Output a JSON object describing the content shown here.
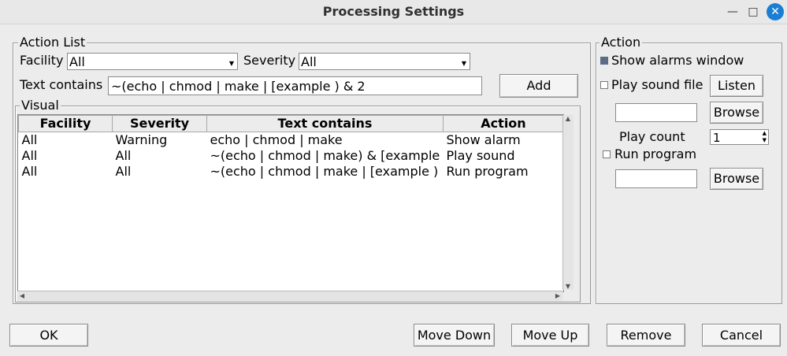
{
  "window": {
    "title": "Processing Settings",
    "minimize_icon": "minimize-icon",
    "maximize_icon": "maximize-icon",
    "close_icon": "close-icon"
  },
  "action_list": {
    "legend": "Action List",
    "facility_label": "Facility",
    "facility_value": "All",
    "severity_label": "Severity",
    "severity_value": "All",
    "text_contains_label": "Text contains",
    "text_contains_value": "~(echo | chmod | make | [example ) & 2",
    "add_label": "Add"
  },
  "visual": {
    "legend": "Visual",
    "columns": [
      "Facility",
      "Severity",
      "Text contains",
      "Action"
    ],
    "rows": [
      {
        "facility": "All",
        "severity": "Warning",
        "text": "echo | chmod | make",
        "action": "Show alarm"
      },
      {
        "facility": "All",
        "severity": "All",
        "text": "~(echo | chmod | make) & [example",
        "action": "Play sound"
      },
      {
        "facility": "All",
        "severity": "All",
        "text": "~(echo | chmod | make | [example )",
        "action": "Run program"
      }
    ]
  },
  "action": {
    "legend": "Action",
    "show_alarms_label": "Show alarms window",
    "show_alarms_checked": true,
    "play_sound_label": "Play sound file",
    "play_sound_checked": false,
    "listen_label": "Listen",
    "sound_file_value": "",
    "browse_label": "Browse",
    "play_count_label": "Play count",
    "play_count_value": "1",
    "run_program_label": "Run program",
    "run_program_checked": false,
    "program_value": "",
    "browse2_label": "Browse"
  },
  "footer": {
    "ok_label": "OK",
    "move_down_label": "Move Down",
    "move_up_label": "Move Up",
    "remove_label": "Remove",
    "cancel_label": "Cancel"
  }
}
